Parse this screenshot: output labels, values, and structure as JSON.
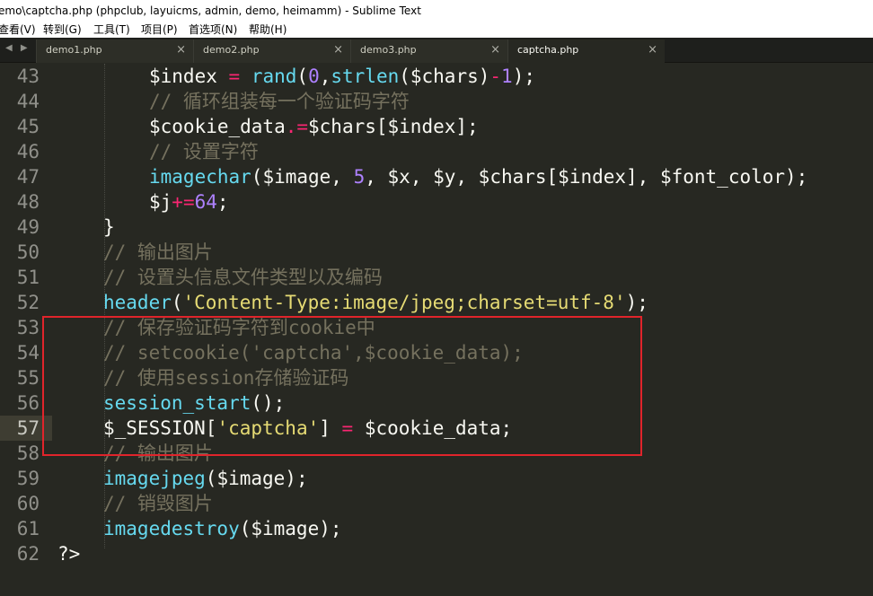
{
  "window": {
    "title": "emo\\captcha.php (phpclub, layuicms, admin, demo, heimamm) - Sublime Text"
  },
  "menu": [
    "查看(V)",
    "转到(G)",
    "工具(T)",
    "项目(P)",
    "首选项(N)",
    "帮助(H)"
  ],
  "tabs": [
    {
      "label": "demo1.php",
      "active": false
    },
    {
      "label": "demo2.php",
      "active": false
    },
    {
      "label": "demo3.php",
      "active": false
    },
    {
      "label": "captcha.php",
      "active": true
    }
  ],
  "tab_arrows": "◀ ▶",
  "tab_close": "×",
  "current_line": "57",
  "code": [
    {
      "n": "43",
      "text": "$index = rand(0,strlen($chars)-1);"
    },
    {
      "n": "44",
      "text": "// 循环组装每一个验证码字符"
    },
    {
      "n": "45",
      "text": "$cookie_data.=$chars[$index];"
    },
    {
      "n": "46",
      "text": "// 设置字符"
    },
    {
      "n": "47",
      "text": "imagechar($image, 5, $x, $y, $chars[$index], $font_color);"
    },
    {
      "n": "48",
      "text": "$j+=64;"
    },
    {
      "n": "49",
      "text": "}"
    },
    {
      "n": "50",
      "text": "// 输出图片"
    },
    {
      "n": "51",
      "text": "// 设置头信息文件类型以及编码"
    },
    {
      "n": "52",
      "text": "header('Content-Type:image/jpeg;charset=utf-8');"
    },
    {
      "n": "53",
      "text": "// 保存验证码字符到cookie中"
    },
    {
      "n": "54",
      "text": "// setcookie('captcha',$cookie_data);"
    },
    {
      "n": "55",
      "text": "// 使用session存储验证码"
    },
    {
      "n": "56",
      "text": "session_start();"
    },
    {
      "n": "57",
      "text": "$_SESSION['captcha'] = $cookie_data;"
    },
    {
      "n": "58",
      "text": "// 输出图片"
    },
    {
      "n": "59",
      "text": "imagejpeg($image);"
    },
    {
      "n": "60",
      "text": "// 销毁图片"
    },
    {
      "n": "61",
      "text": "imagedestroy($image);"
    },
    {
      "n": "62",
      "text": "?>"
    }
  ],
  "colors": {
    "background": "#272822",
    "keyword_function": "#66d9ef",
    "operator": "#f92672",
    "number": "#ae81ff",
    "string": "#e6db74",
    "comment": "#75715e",
    "annotation_box": "#e0242b"
  }
}
